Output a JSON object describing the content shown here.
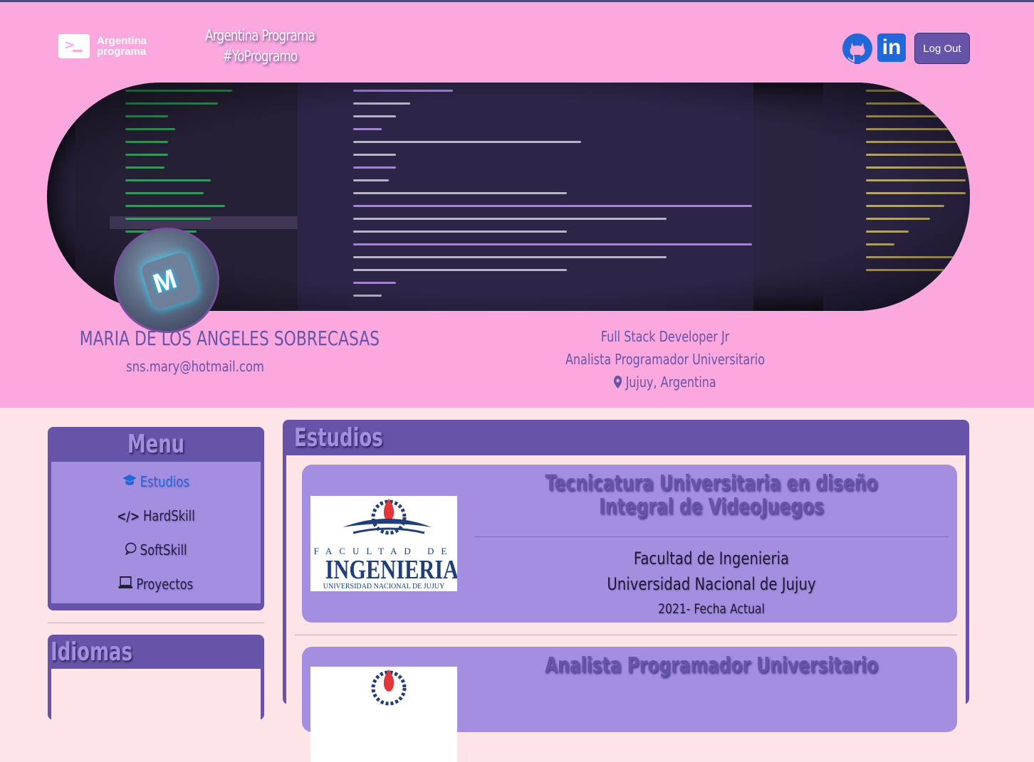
{
  "header": {
    "logo_line1": "Argentina",
    "logo_line2": "programa",
    "brand_line1": "Argentina Programa",
    "brand_line2": "#YoProgramo",
    "logout_label": "Log Out",
    "linkedin_label": "in"
  },
  "profile": {
    "avatar_letter": "M",
    "name": "MARIA DE LOS ANGELES SOBRECASAS",
    "email": "sns.mary@hotmail.com",
    "title1": "Full Stack Developer Jr",
    "title2": "Analista Programador Universitario",
    "location": "Jujuy, Argentina"
  },
  "menu": {
    "title": "Menu",
    "items": [
      {
        "label": "Estudios",
        "icon": "graduation-cap-icon"
      },
      {
        "label": "HardSkill",
        "icon": "code-icon"
      },
      {
        "label": "SoftSkill",
        "icon": "chat-icon"
      },
      {
        "label": "Proyectos",
        "icon": "laptop-icon"
      }
    ]
  },
  "idiomas": {
    "title": "Idiomas"
  },
  "estudios": {
    "title": "Estudios",
    "cards": [
      {
        "title": "Tecnicatura Universitaria en diseño Integral de VideoJuegos",
        "institution1": "Facultad de Ingenieria",
        "institution2": "Universidad Nacional de Jujuy",
        "dates": "2021- Fecha Actual",
        "logo": {
          "line1": "FACULTAD DE",
          "line2": "INGENIERIA",
          "line3": "UNIVERSIDAD NACIONAL DE JUJUY"
        }
      },
      {
        "title": "Analista Programador Universitario",
        "logo": {
          "line1": "",
          "line2": "",
          "line3": ""
        }
      }
    ]
  },
  "colors": {
    "header_bg": "#fba8df",
    "page_bg": "#fde4e6",
    "panel": "#6554a8",
    "panel_light": "#a48ee0",
    "link_blue": "#2267d8"
  }
}
